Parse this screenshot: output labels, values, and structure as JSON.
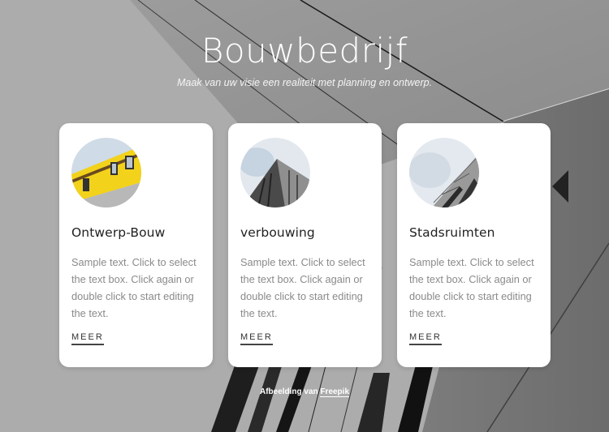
{
  "hero": {
    "title": "Bouwbedrijf",
    "subtitle": "Maak van uw visie een realiteit met planning en ontwerp."
  },
  "cards": [
    {
      "image": "yellow-building-facade-image",
      "title": "Ontwerp-Bouw",
      "body": "Sample text. Click to select the text box. Click again or double click to start editing the text.",
      "link_label": "MEER"
    },
    {
      "image": "concrete-tower-corner-image",
      "title": "verbouwing",
      "body": "Sample text. Click to select the text box. Click again or double click to start editing the text.",
      "link_label": "MEER"
    },
    {
      "image": "glass-balconies-building-image",
      "title": "Stadsruimten",
      "body": "Sample text. Click to select the text box. Click again or double click to start editing the text.",
      "link_label": "MEER"
    }
  ],
  "credit": {
    "prefix": "Afbeelding van",
    "link": "Freepik"
  },
  "colors": {
    "card_bg": "#ffffff",
    "title_text": "#1f1f1f",
    "body_text": "#8a8a8a",
    "hero_text": "#ffffff"
  }
}
